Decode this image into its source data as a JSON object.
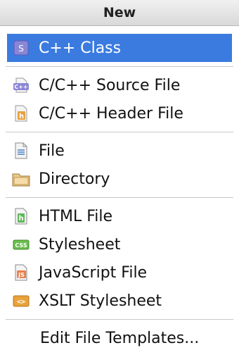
{
  "header": {
    "title": "New"
  },
  "groups": [
    [
      {
        "label": "C++ Class",
        "icon": "cpp-class-icon",
        "selected": true
      }
    ],
    [
      {
        "label": "C/C++ Source File",
        "icon": "cpp-source-file-icon"
      },
      {
        "label": "C/C++ Header File",
        "icon": "cpp-header-file-icon"
      }
    ],
    [
      {
        "label": "File",
        "icon": "text-file-icon"
      },
      {
        "label": "Directory",
        "icon": "folder-icon"
      }
    ],
    [
      {
        "label": "HTML File",
        "icon": "html-file-icon"
      },
      {
        "label": "Stylesheet",
        "icon": "css-file-icon"
      },
      {
        "label": "JavaScript File",
        "icon": "javascript-file-icon"
      },
      {
        "label": "XSLT Stylesheet",
        "icon": "xslt-file-icon"
      }
    ],
    [
      {
        "label": "Edit File Templates...",
        "icon": ""
      }
    ]
  ],
  "colors": {
    "selection": "#3b7be0",
    "separator": "#c9c9c9"
  }
}
